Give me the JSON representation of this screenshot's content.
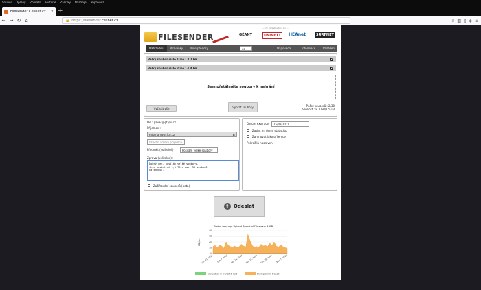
{
  "browser": {
    "menu": [
      "Soubor",
      "Úpravy",
      "Zobrazit",
      "Historie",
      "Záložky",
      "Nástroje",
      "Nápověda"
    ],
    "tab_title": "Filesender Cesnet.cz",
    "tab_close": "×",
    "new_tab": "+",
    "url_prefix": "https://filesender.",
    "url_domain": "cesnet.cz",
    "nav": {
      "back": "←",
      "forward": "→",
      "reload": "↻",
      "home": "⌂",
      "more": "···"
    }
  },
  "header": {
    "logo_text": "FILESENDER",
    "supported_by": "— 75 Infrastructure by —",
    "partners": [
      "GÉANT",
      "UNINETT",
      "HEAnet",
      "SURFNET"
    ]
  },
  "menu": {
    "upload": "Nahrávání",
    "invites": "Pozvánky",
    "my_transfers": "Moje přenosy",
    "lang": "cs",
    "help": "Nápověda",
    "about": "Informace",
    "logout": "Odhlášení"
  },
  "upload": {
    "files": [
      "Velký soubor číslo 1.iso : 3.7 GB",
      "Velký soubor číslo 2.iso : 4.4 GB"
    ],
    "dropzone": "Sem přetáhněte soubory k nahrání",
    "clear_all": "Vyčistit vše",
    "select_files": "Vybrat soubory",
    "count": "Počet souborů : 2/30",
    "size": "Velikost : 8.1 GB/1.5 TB"
  },
  "form": {
    "from": "Od : pavac@pf.jcu.cz",
    "recipients_label": "Příjemce :",
    "recipient": "mtoman@pf.jcu.cz",
    "recipient_placeholder": "Všechn adresy příjemce",
    "subject_label": "Předmět (volitelné) :",
    "subject": "Posílám velké soubory",
    "message_label": "Zpráva (volitelné) :",
    "message": "Dobrý den, posílám velké soubory.\n(Lze poslat až 1,5 TB a max. 30 souborů\nnajednou).",
    "encrypt_label": "Zašifrování souborů (beta)",
    "expiry_label": "Datum expirace:",
    "expiry": "15/03/2021",
    "opt1": "Zaslat mi denní statistiku",
    "opt2": "Zahrnovat jako příjemce",
    "advanced": "Pokročilá nastavení"
  },
  "send_label": "Odeslat",
  "chart_data": {
    "type": "area",
    "title": "Global Average Upload Speed of Files over 1 GB",
    "ylabel": "MB/sec",
    "yticks": [
      0,
      10,
      20,
      30,
      40
    ],
    "ylim": [
      0,
      40
    ],
    "xticks": [
      "Jan 31, 2021",
      "Feb 7, 2021",
      "Feb 14, 2021",
      "Feb 21, 2021",
      "Feb 28, 2021",
      "Mar 7, 2021"
    ],
    "series": [
      {
        "name": "Encryption in transit & rest",
        "color": "#7cd37c",
        "values": [
          0,
          0,
          0,
          0,
          0,
          0,
          0,
          0,
          0,
          0,
          0,
          0,
          0,
          0,
          0,
          0,
          0,
          0,
          0,
          0,
          0,
          0,
          0,
          0,
          0,
          0,
          0,
          0,
          0,
          0,
          0,
          0,
          0,
          0,
          0
        ]
      },
      {
        "name": "Encryption in transit",
        "color": "#f5b25a",
        "values": [
          12,
          14,
          10,
          15,
          13,
          9,
          20,
          14,
          12,
          11,
          13,
          10,
          12,
          16,
          13,
          11,
          33,
          22,
          14,
          10,
          12,
          11,
          16,
          13,
          14,
          12,
          18,
          14,
          20,
          13,
          11,
          15,
          12,
          10,
          9
        ]
      }
    ]
  }
}
